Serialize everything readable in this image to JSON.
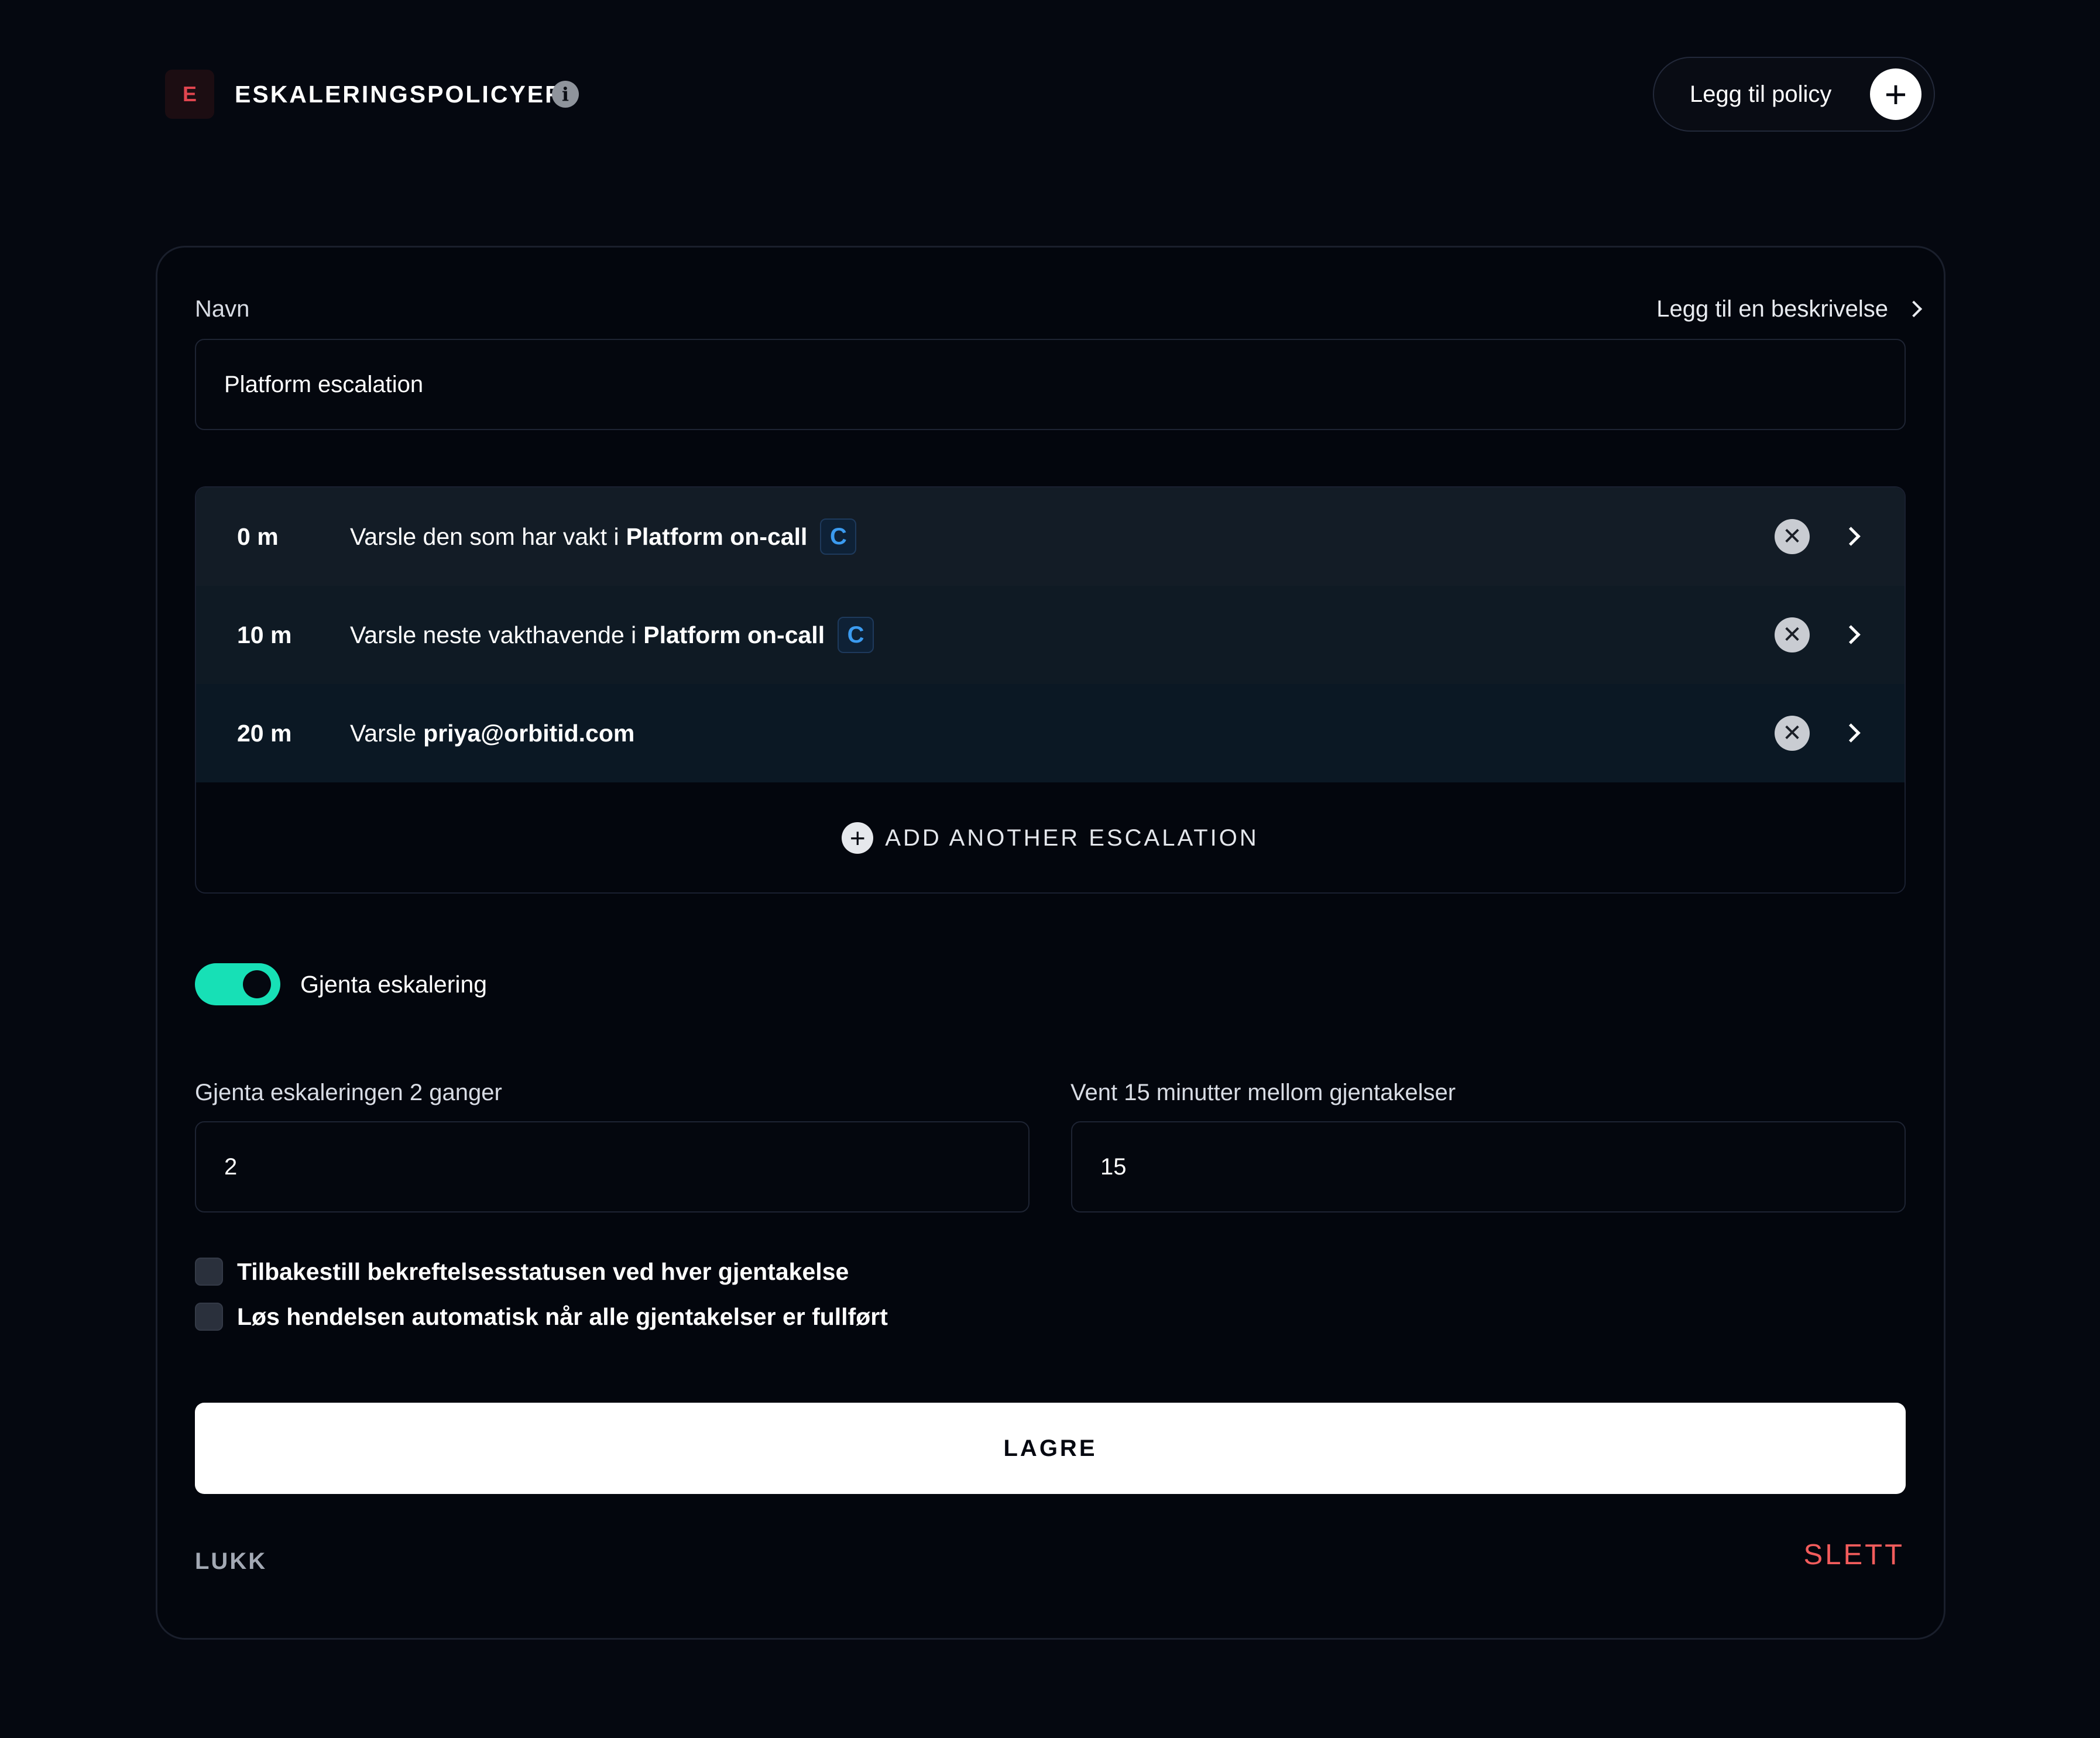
{
  "header": {
    "logo_letter": "E",
    "title": "ESKALERINGSPOLICYER",
    "info_icon": "info-icon",
    "add_policy_label": "Legg til policy",
    "add_policy_icon": "plus-icon"
  },
  "form": {
    "name_label": "Navn",
    "add_description_label": "Legg til en beskrivelse",
    "name_value": "Platform escalation",
    "escalations": [
      {
        "delay": "0 m",
        "text": "Varsle den som har vakt i",
        "target": "Platform on-call",
        "badge": "C"
      },
      {
        "delay": "10 m",
        "text": "Varsle neste vakthavende i",
        "target": "Platform on-call",
        "badge": "C"
      },
      {
        "delay": "20 m",
        "text": "Varsle",
        "target": "priya@orbitid.com",
        "badge": ""
      }
    ],
    "add_escalation_label": "ADD ANOTHER ESCALATION",
    "repeat_toggle_label": "Gjenta eskalering",
    "repeat_toggle_on": true,
    "repeat_count_label": "Gjenta eskaleringen 2 ganger",
    "repeat_count_value": "2",
    "repeat_wait_label": "Vent 15 minutter mellom gjentakelser",
    "repeat_wait_value": "15",
    "checkbox_reset_label": "Tilbakestill bekreftelsesstatusen ved hver gjentakelse",
    "checkbox_reset_checked": false,
    "checkbox_resolve_label": "Løs hendelsen automatisk når alle gjentakelser er fullført",
    "checkbox_resolve_checked": false,
    "save_label": "LAGRE",
    "close_label": "LUKK",
    "delete_label": "SLETT"
  },
  "colors": {
    "background": "#050810",
    "accent_toggle": "#17e0b6",
    "danger": "#f25c5c",
    "schedule_badge": "#3b9bf0",
    "logo": "#e0454f"
  }
}
